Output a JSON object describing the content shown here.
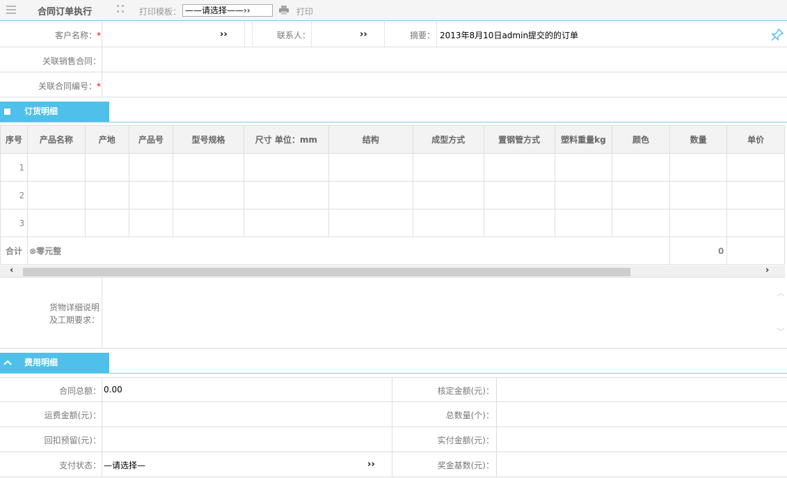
{
  "toolbar": {
    "title": "合同订单执行",
    "print_template_label": "打印模板：",
    "print_template_value": "——请选择——››",
    "print_label": "打印",
    "menu_icon": "menu-icon",
    "grip_icon": "grip-icon",
    "printer_icon": "printer-icon"
  },
  "form": {
    "customer_label": "客户名称：",
    "required_mark": "*",
    "customer_value": "",
    "contact_label": "联系人：",
    "contact_value": "",
    "summary_label": "摘要：",
    "summary_value": "2013年8月10日admin提交的的订单",
    "pin_icon": "pin-icon",
    "related_sales_label": "关联销售合同：",
    "related_sales_value": "",
    "related_no_label": "关联合同编号：",
    "related_no_value": "",
    "chevron": "››"
  },
  "order_section": {
    "title": "订货明细",
    "columns": [
      "序号",
      "产品名称",
      "产地",
      "产品号",
      "型号规格",
      "尺寸 单位：mm",
      "结构",
      "成型方式",
      "置钢管方式",
      "塑料重量kg",
      "颜色",
      "数量",
      "单价"
    ],
    "rows": [
      {
        "index": "1"
      },
      {
        "index": "2"
      },
      {
        "index": "3"
      }
    ],
    "total_label": "合计",
    "total_text": "⊗零元整",
    "total_quantity": "0",
    "scroll_left": "‹",
    "scroll_right": "›"
  },
  "goods_desc": {
    "label_line1": "货物详细说明",
    "label_line2": "及工期要求：",
    "value": "",
    "scroll_up": "︿",
    "scroll_down": "﹀"
  },
  "fee_section": {
    "title": "费用明细",
    "collapse_icon": "chevron-up-icon",
    "contract_total_label": "合同总额：",
    "contract_total_value": "0.00",
    "approved_amount_label": "核定金额(元)：",
    "approved_amount_value": "",
    "freight_label": "运费金额(元)：",
    "freight_value": "",
    "total_count_label": "总数量(个)：",
    "total_count_value": "",
    "rebate_label": "回扣预留(元)：",
    "rebate_value": "",
    "paid_label": "实付金额(元)：",
    "paid_value": "",
    "pay_status_label": "支付状态：",
    "pay_status_value": "—请选择—",
    "bonus_base_label": "奖金基数(元)：",
    "bonus_base_value": ""
  },
  "colors": {
    "accent": "#4fc0ea",
    "required": "#dd0000"
  }
}
